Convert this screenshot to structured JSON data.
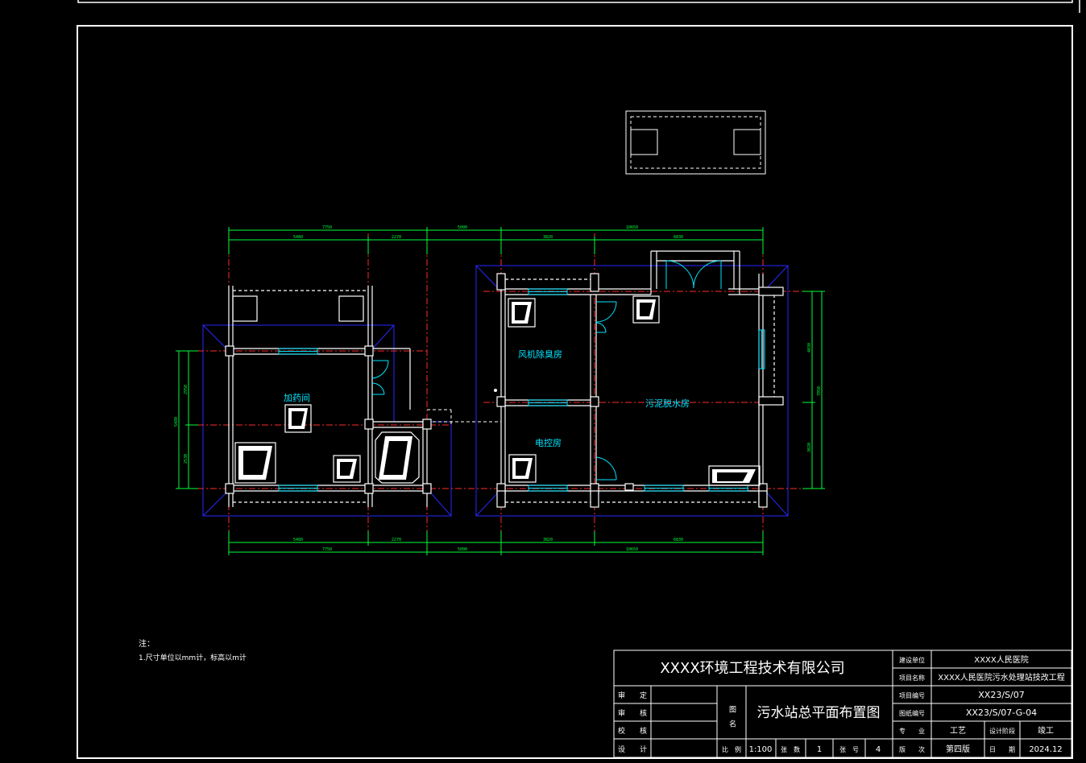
{
  "drawing": {
    "rooms": {
      "dosing_room": "加药间",
      "fan_deodorizing_room": "风机除臭房",
      "electrical_control_room": "电控房",
      "sludge_dewatering_room": "污泥脱水房"
    },
    "dimensions": {
      "top_overall_left": "7750",
      "top_gap": "5000",
      "top_overall_right": "10650",
      "top_sub_1": "5480",
      "top_sub_2": "2270",
      "top_sub_3": "3820",
      "top_sub_4": "6830",
      "bottom_sub_1": "5480",
      "bottom_sub_2": "2270",
      "bottom_sub_3": "3820",
      "bottom_sub_4": "6830",
      "bottom_overall_left": "7750",
      "bottom_gap": "5000",
      "bottom_overall_right": "10650",
      "left_overall": "5480",
      "left_sub_1": "2950",
      "left_sub_2": "2530",
      "right_overall": "7050",
      "right_sub_1": "4030",
      "right_sub_2": "3020"
    },
    "notes": {
      "heading": "注：",
      "line1": "1.尺寸单位以mm计，标高以m计"
    }
  },
  "title_block": {
    "company": "XXXX环境工程技术有限公司",
    "roles": {
      "review": "审　　定",
      "check": "审　　核",
      "proof": "校　　核",
      "design": "设　　计"
    },
    "drawing_name_label": "图　名",
    "drawing_name": "污水站总平面布置图",
    "fields": {
      "client_label": "建设单位",
      "client_value": "XXXX人民医院",
      "project_name_label": "项目名称",
      "project_name_value": "XXXX人民医院污水处理站技改工程",
      "project_no_label": "项目编号",
      "project_no_value": "XX23/S/07",
      "drawing_no_label": "图纸编号",
      "drawing_no_value": "XX23/S/07-G-04",
      "discipline_label": "专　　业",
      "discipline_value": "工艺",
      "design_stage_label": "设计阶段",
      "design_stage_value": "竣工",
      "version_label": "版　　次",
      "version_value": "第四版",
      "date_label": "日　　期",
      "date_value": "2024.12",
      "scale_label": "比　例",
      "scale_value": "1:100",
      "sheet_count_label": "张　数",
      "sheet_count_value": "1",
      "sheet_no_label": "张　号",
      "sheet_no_value": "4"
    }
  },
  "colors": {
    "background": "#000000",
    "wall": "#ffffff",
    "axis": "#ff2a2a",
    "dimension": "#00ff3c",
    "roof_outline": "#2222ff",
    "window": "#00e5ff",
    "room_label": "#00e5ff"
  }
}
